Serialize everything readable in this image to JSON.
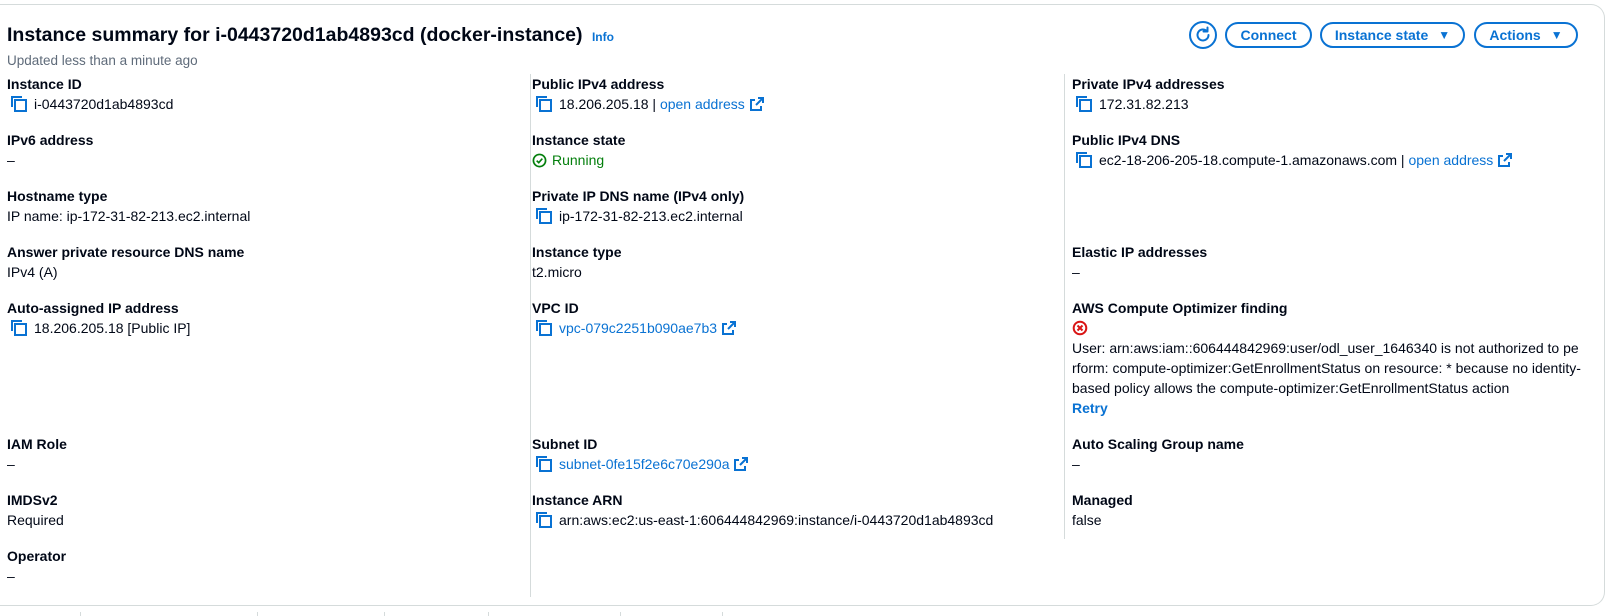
{
  "header": {
    "title": "Instance summary for i-0443720d1ab4893cd (docker-instance)",
    "info_label": "Info",
    "updated": "Updated less than a minute ago",
    "connect_label": "Connect",
    "instance_state_label": "Instance state",
    "actions_label": "Actions"
  },
  "col1": {
    "instance_id": {
      "label": "Instance ID",
      "value": "i-0443720d1ab4893cd"
    },
    "ipv6": {
      "label": "IPv6 address",
      "value": "–"
    },
    "hostname_type": {
      "label": "Hostname type",
      "value": "IP name: ip-172-31-82-213.ec2.internal"
    },
    "answer_dns": {
      "label": "Answer private resource DNS name",
      "value": "IPv4 (A)"
    },
    "auto_ip": {
      "label": "Auto-assigned IP address",
      "value": "18.206.205.18 [Public IP]"
    },
    "iam_role": {
      "label": "IAM Role",
      "value": "–"
    },
    "imdsv2": {
      "label": "IMDSv2",
      "value": "Required"
    },
    "operator": {
      "label": "Operator",
      "value": "–"
    }
  },
  "col2": {
    "public_ipv4": {
      "label": "Public IPv4 address",
      "value": "18.206.205.18",
      "sep": " | ",
      "link": "open address"
    },
    "instance_state": {
      "label": "Instance state",
      "value": "Running"
    },
    "private_dns": {
      "label": "Private IP DNS name (IPv4 only)",
      "value": "ip-172-31-82-213.ec2.internal"
    },
    "instance_type": {
      "label": "Instance type",
      "value": "t2.micro"
    },
    "vpc_id": {
      "label": "VPC ID",
      "value": "vpc-079c2251b090ae7b3"
    },
    "subnet_id": {
      "label": "Subnet ID",
      "value": "subnet-0fe15f2e6c70e290a"
    },
    "instance_arn": {
      "label": "Instance ARN",
      "value": "arn:aws:ec2:us-east-1:606444842969:instance/i-0443720d1ab4893cd"
    }
  },
  "col3": {
    "private_ipv4": {
      "label": "Private IPv4 addresses",
      "value": "172.31.82.213"
    },
    "public_dns": {
      "label": "Public IPv4 DNS",
      "value": "ec2-18-206-205-18.compute-1.amazonaws.com",
      "sep": " | ",
      "link": "open address"
    },
    "elastic_ip": {
      "label": "Elastic IP addresses",
      "value": "–"
    },
    "optimizer": {
      "label": "AWS Compute Optimizer finding",
      "error": "User: arn:aws:iam::606444842969:user/odl_user_1646340 is not authorized to perform: compute-optimizer:GetEnrollmentStatus on resource: * because no identity-based policy allows the compute-optimizer:GetEnrollmentStatus action",
      "retry": "Retry"
    },
    "asg": {
      "label": "Auto Scaling Group name",
      "value": "–"
    },
    "managed": {
      "label": "Managed",
      "value": "false"
    }
  },
  "colors": {
    "link": "#0972d3",
    "success": "#037f0c",
    "error": "#d91515",
    "divider": "#d5dbdb"
  },
  "icons": [
    "refresh-icon",
    "copy-icon",
    "external-link-icon",
    "status-success-icon",
    "status-error-icon",
    "caret-down-icon"
  ]
}
